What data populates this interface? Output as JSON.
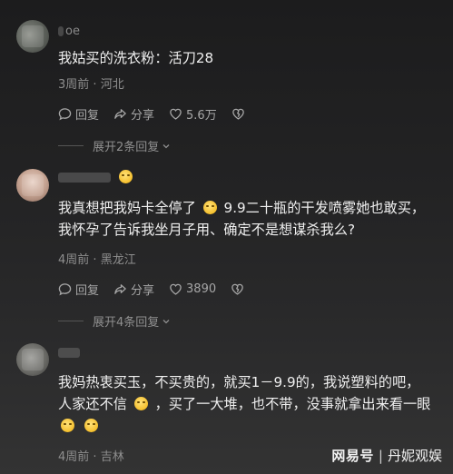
{
  "comments": [
    {
      "username_visible": "oe",
      "text_lines": [
        "我姑买的洗衣粉：活刀28"
      ],
      "time": "3周前",
      "location": "河北",
      "reply_label": "回复",
      "share_label": "分享",
      "likes": "5.6万",
      "expand_label": "展开2条回复"
    },
    {
      "username_visible": "",
      "text_line1_a": "我真想把我妈卡全停了",
      "text_line1_b": "9.9二十瓶的干发喷雾她也敢买，",
      "text_line2": "我怀孕了告诉我坐月子用、确定不是想谋杀我么?",
      "time": "4周前",
      "location": "黑龙江",
      "reply_label": "回复",
      "share_label": "分享",
      "likes": "3890",
      "expand_label": "展开4条回复"
    },
    {
      "username_visible": "",
      "text_line1": "我妈热衷买玉，不买贵的，就买1－9.9的，我说塑料的吧，",
      "text_line2_a": "人家还不信",
      "text_line2_b": "，买了一大堆，也不带，没事就拿出来看一眼",
      "time": "4周前",
      "location": "吉林"
    }
  ],
  "watermark": {
    "logo": "网易号",
    "separator": "|",
    "author": "丹妮观娱"
  },
  "colors": {
    "background": "#262627",
    "text": "#efefef",
    "meta": "#8f8f8f"
  }
}
